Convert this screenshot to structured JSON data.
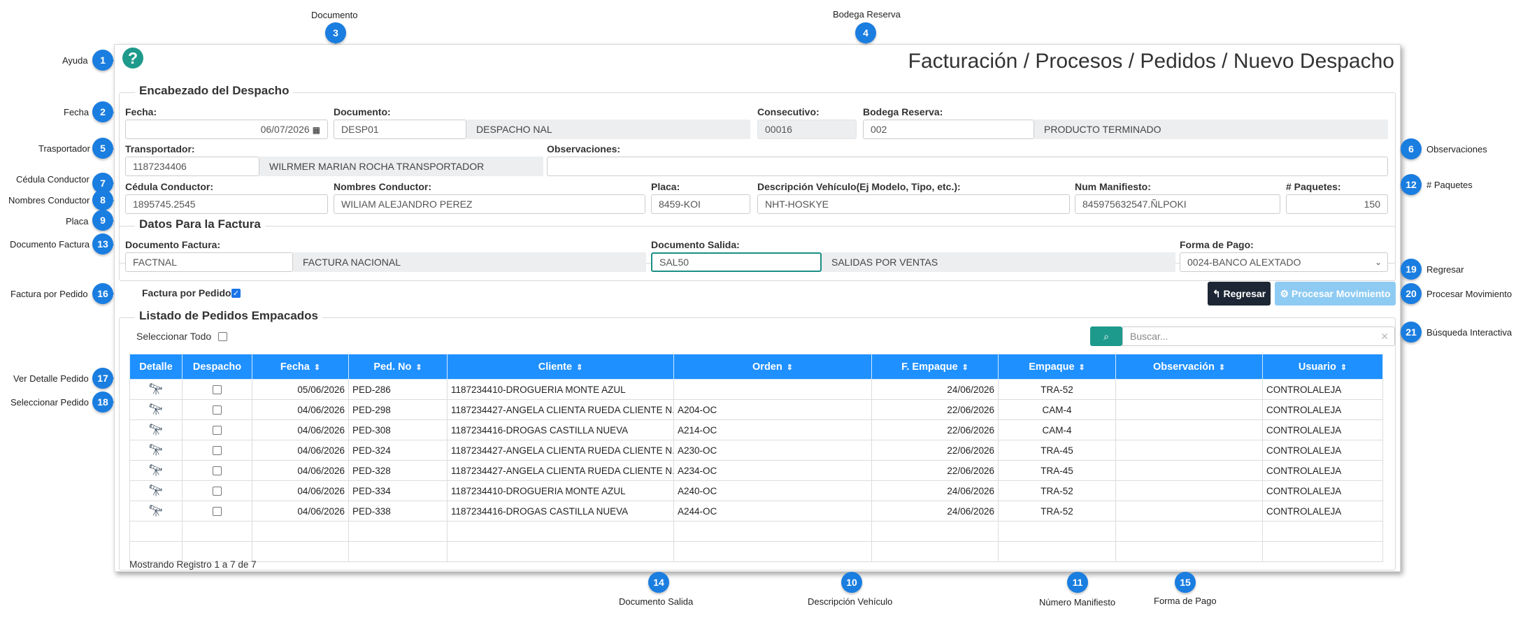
{
  "page_title": "Facturación / Procesos / Pedidos / Nuevo Despacho",
  "header_section": {
    "legend": "Encabezado del Despacho",
    "fecha": {
      "label": "Fecha:",
      "value": "06/07/2026"
    },
    "documento": {
      "label": "Documento:",
      "code": "DESP01",
      "desc": "DESPACHO NAL"
    },
    "consecutivo": {
      "label": "Consecutivo:",
      "value": "00016"
    },
    "bodega": {
      "label": "Bodega Reserva:",
      "code": "002",
      "desc": "PRODUCTO TERMINADO"
    },
    "transportador": {
      "label": "Transportador:",
      "code": "1187234406",
      "desc": "WILRMER MARIAN ROCHA TRANSPORTADOR"
    },
    "observaciones": {
      "label": "Observaciones:",
      "value": ""
    },
    "cedula": {
      "label": "Cédula Conductor:",
      "value": "1895745.2545"
    },
    "nombres": {
      "label": "Nombres Conductor:",
      "value": "WILIAM ALEJANDRO PEREZ"
    },
    "placa": {
      "label": "Placa:",
      "value": "8459-KOI"
    },
    "descripcion_vehiculo": {
      "label": "Descripción Vehículo(Ej Modelo, Tipo, etc.):",
      "value": "NHT-HOSKYE"
    },
    "num_manifiesto": {
      "label": "Num Manifiesto:",
      "value": "845975632547.ÑLPOKI"
    },
    "paquetes": {
      "label": "# Paquetes:",
      "value": "150"
    }
  },
  "invoice_section": {
    "legend": "Datos Para la Factura",
    "documento_factura": {
      "label": "Documento Factura:",
      "code": "FACTNAL",
      "desc": "FACTURA NACIONAL"
    },
    "documento_salida": {
      "label": "Documento Salida:",
      "code": "SAL50",
      "desc": "SALIDAS POR VENTAS"
    },
    "forma_pago": {
      "label": "Forma de Pago:",
      "value": "0024-BANCO ALEXTADO"
    }
  },
  "factura_por_pedido": {
    "label": "Factura por Pedido",
    "checked": true
  },
  "buttons": {
    "regresar": "Regresar",
    "procesar": "Procesar Movimiento"
  },
  "orders": {
    "legend": "Listado de Pedidos Empacados",
    "select_all": "Seleccionar Todo",
    "search_placeholder": "Buscar...",
    "columns": [
      "Detalle",
      "Despacho",
      "Fecha",
      "Ped. No",
      "Cliente",
      "Orden",
      "F. Empaque",
      "Empaque",
      "Observación",
      "Usuario"
    ],
    "rows": [
      {
        "fecha": "05/06/2026",
        "ped": "PED-286",
        "cliente": "1187234410-DROGUERIA MONTE AZUL",
        "orden": "",
        "f_empaque": "24/06/2026",
        "empaque": "TRA-52",
        "obs": "",
        "usuario": "CONTROLALEJA"
      },
      {
        "fecha": "04/06/2026",
        "ped": "PED-298",
        "cliente": "1187234427-ANGELA CLIENTA RUEDA CLIENTE N...",
        "orden": "A204-OC",
        "f_empaque": "22/06/2026",
        "empaque": "CAM-4",
        "obs": "",
        "usuario": "CONTROLALEJA"
      },
      {
        "fecha": "04/06/2026",
        "ped": "PED-308",
        "cliente": "1187234416-DROGAS CASTILLA NUEVA",
        "orden": "A214-OC",
        "f_empaque": "22/06/2026",
        "empaque": "CAM-4",
        "obs": "",
        "usuario": "CONTROLALEJA"
      },
      {
        "fecha": "04/06/2026",
        "ped": "PED-324",
        "cliente": "1187234427-ANGELA CLIENTA RUEDA CLIENTE N...",
        "orden": "A230-OC",
        "f_empaque": "22/06/2026",
        "empaque": "TRA-45",
        "obs": "",
        "usuario": "CONTROLALEJA"
      },
      {
        "fecha": "04/06/2026",
        "ped": "PED-328",
        "cliente": "1187234427-ANGELA CLIENTA RUEDA CLIENTE N...",
        "orden": "A234-OC",
        "f_empaque": "22/06/2026",
        "empaque": "TRA-45",
        "obs": "",
        "usuario": "CONTROLALEJA"
      },
      {
        "fecha": "04/06/2026",
        "ped": "PED-334",
        "cliente": "1187234410-DROGUERIA MONTE AZUL",
        "orden": "A240-OC",
        "f_empaque": "24/06/2026",
        "empaque": "TRA-52",
        "obs": "",
        "usuario": "CONTROLALEJA"
      },
      {
        "fecha": "04/06/2026",
        "ped": "PED-338",
        "cliente": "1187234416-DROGAS CASTILLA NUEVA",
        "orden": "A244-OC",
        "f_empaque": "24/06/2026",
        "empaque": "TRA-52",
        "obs": "",
        "usuario": "CONTROLALEJA"
      }
    ],
    "footer": "Mostrando Registro 1 a 7 de 7"
  },
  "annotations": [
    {
      "num": "1",
      "text": "Ayuda"
    },
    {
      "num": "2",
      "text": "Fecha"
    },
    {
      "num": "3",
      "text": "Documento"
    },
    {
      "num": "4",
      "text": "Bodega Reserva"
    },
    {
      "num": "5",
      "text": "Trasportador"
    },
    {
      "num": "6",
      "text": "Observaciones"
    },
    {
      "num": "7",
      "text": "Cédula Conductor"
    },
    {
      "num": "8",
      "text": "Nombres Conductor"
    },
    {
      "num": "9",
      "text": "Placa"
    },
    {
      "num": "10",
      "text": "Descripción Vehículo"
    },
    {
      "num": "11",
      "text": "Número Manifiesto"
    },
    {
      "num": "12",
      "text": "# Paquetes"
    },
    {
      "num": "13",
      "text": "Documento Factura"
    },
    {
      "num": "14",
      "text": "Documento Salida"
    },
    {
      "num": "15",
      "text": "Forma de Pago"
    },
    {
      "num": "16",
      "text": "Factura por Pedido"
    },
    {
      "num": "17",
      "text": "Ver Detalle Pedido"
    },
    {
      "num": "18",
      "text": "Seleccionar Pedido"
    },
    {
      "num": "19",
      "text": "Regresar"
    },
    {
      "num": "20",
      "text": "Procesar Movimiento"
    },
    {
      "num": "21",
      "text": "Búsqueda Interactiva"
    }
  ]
}
